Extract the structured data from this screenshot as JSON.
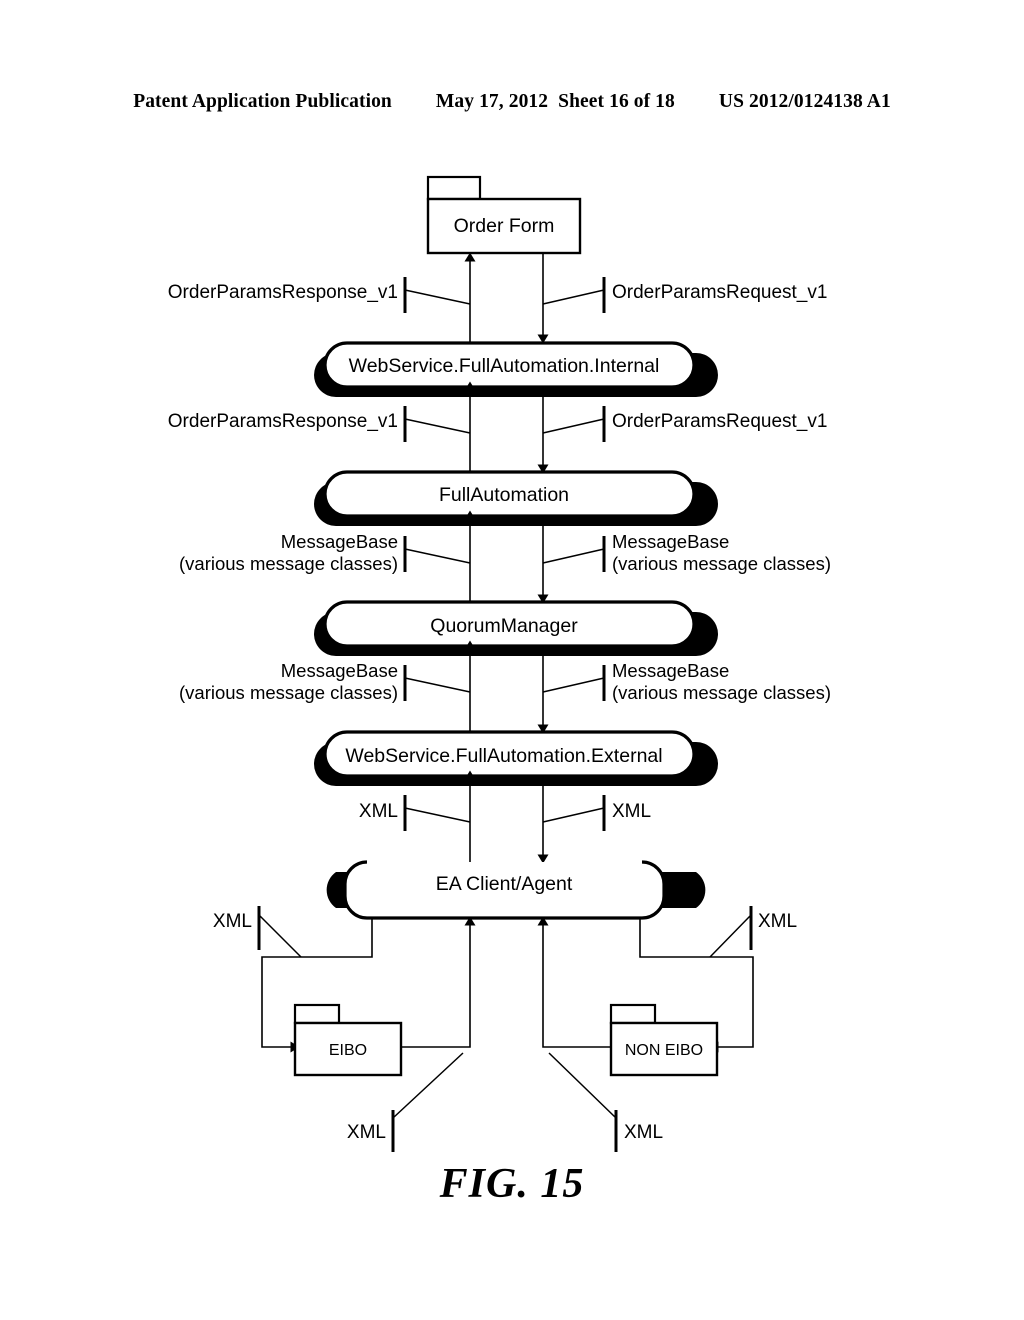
{
  "header": {
    "publication": "Patent Application Publication",
    "date": "May 17, 2012",
    "sheet": "Sheet 16 of 18",
    "number": "US 2012/0124138 A1"
  },
  "figure": {
    "caption": "FIG. 15",
    "type": "flow-diagram"
  },
  "nodes": {
    "order_form": "Order Form",
    "ws_internal": "WebService.FullAutomation.Internal",
    "full_automation": "FullAutomation",
    "quorum_manager": "QuorumManager",
    "ws_external": "WebService.FullAutomation.External",
    "ea_client": "EA Client/Agent",
    "eibo": "EIBO",
    "non_eibo": "NON EIBO"
  },
  "edge_labels": {
    "resp_v1_a": "OrderParamsResponse_v1",
    "req_v1_a": "OrderParamsRequest_v1",
    "resp_v1_b": "OrderParamsResponse_v1",
    "req_v1_b": "OrderParamsRequest_v1",
    "msgbase_1_left_l1": "MessageBase",
    "msgbase_1_left_l2": "(various message classes)",
    "msgbase_1_right_l1": "MessageBase",
    "msgbase_1_right_l2": "(various message classes)",
    "msgbase_2_left_l1": "MessageBase",
    "msgbase_2_left_l2": "(various message classes)",
    "msgbase_2_right_l1": "MessageBase",
    "msgbase_2_right_l2": "(various message classes)",
    "xml_ws_left": "XML",
    "xml_ws_right": "XML",
    "xml_ea_left": "XML",
    "xml_ea_right": "XML",
    "xml_bottom_left": "XML",
    "xml_bottom_right": "XML"
  }
}
